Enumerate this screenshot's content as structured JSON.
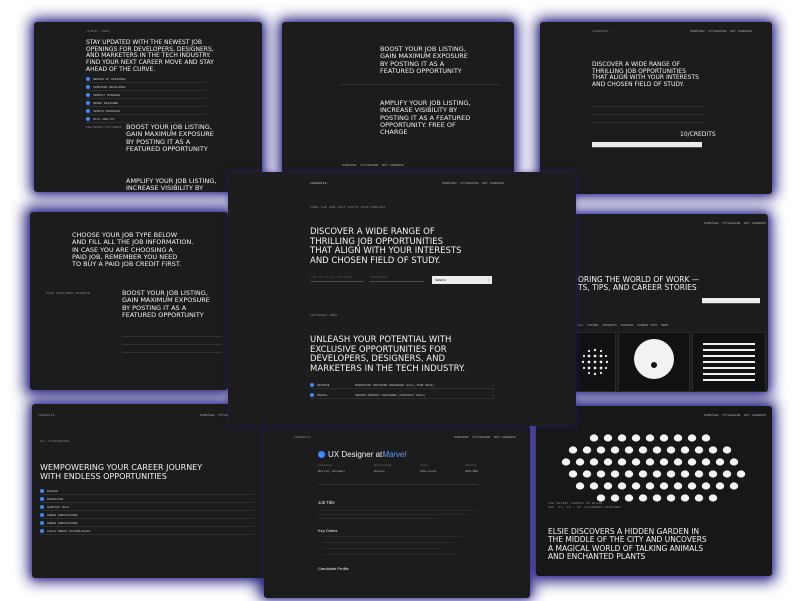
{
  "panels": {
    "p1": {
      "label": "LATEST JOBS",
      "headline": "STAY UPDATED WITH THE NEWEST JOB\nOPENINGS FOR DEVELOPERS, DESIGNERS,\nAND MARKETERS IN THE TECH INDUSTRY.\nFIND YOUR NEXT CAREER MOVE AND STAY\nAHEAD OF THE CURVE.",
      "rows": [
        "SENIOR UX DESIGNER",
        "FRONTEND DEVELOPER",
        "PRODUCT MANAGER",
        "BRAND DESIGNER",
        "GROWTH MARKETER",
        "DATA ANALYST"
      ],
      "section_label": "FEATURED LISTINGS",
      "boost": "BOOST YOUR JOB LISTING,\nGAIN MAXIMUM EXPOSURE\nBY POSTING IT AS A\nFEATURED OPPORTUNITY",
      "amplify": "AMPLIFY YOUR JOB LISTING,\nINCREASE VISIBILITY BY"
    },
    "p2": {
      "nav": [
        "OVERVIEW",
        "STYLEGUIDE",
        "BUY CAREERIA"
      ],
      "boost": "BOOST YOUR JOB LISTING,\nGAIN MAXIMUM EXPOSURE\nBY POSTING IT AS A\nFEATURED OPPORTUNITY",
      "amplify": "AMPLIFY YOUR JOB LISTING,\nINCREASE VISIBILITY BY\nPOSTING IT AS A FEATURED\nOPPORTUNITY. FREE OF\nCHARGE"
    },
    "p3": {
      "brand": "CAREERIA",
      "nav": [
        "OVERVIEW",
        "STYLEGUIDE",
        "BUY CAREERIA"
      ],
      "headline": "DISCOVER A WIDE RANGE OF\nTHRILLING JOB OPPORTUNITIES\nTHAT ALIGN WITH YOUR INTERESTS\nAND CHOSEN FIELD OF STUDY.",
      "credits": "10/CREDITS"
    },
    "p4": {
      "headline": "CHOOSE YOUR JOB TYPE BELOW\nAND FILL ALL THE JOB INFORMATION.\nIN CASE YOU ARE CHOOSING A\nPAID JOB, REMEMBER YOU NEED\nTO BUY A PAID JOB CREDIT FIRST.",
      "label": "PAID FEATURED PROMOTE",
      "boost": "BOOST YOUR JOB LISTING,\nGAIN MAXIMUM EXPOSURE\nBY POSTING IT AS A\nFEATURED OPPORTUNITY"
    },
    "p5": {
      "brand": "CAREERIA",
      "nav": [
        "OVERVIEW",
        "STYLEGUIDE",
        "BUY CAREERIA"
      ],
      "eyebrow": "FIND THE JOB THAT SUITS YOUR PROFILE",
      "headline": "DISCOVER A WIDE RANGE OF\nTHRILLING JOB OPPORTUNITIES\nTHAT ALIGN WITH YOUR INTERESTS\nAND CHOSEN FIELD OF STUDY.",
      "search_placeholder": "JOB TITLE OR KEYWORD",
      "location_placeholder": "LOCATION",
      "search_button": "SEARCH",
      "featured_label": "FEATURED JOBS",
      "unleash": "UNLEASH YOUR POTENTIAL WITH\nEXCLUSIVE OPPORTUNITIES FOR\nDEVELOPERS, DESIGNERS, AND\nMARKETERS IN THE TECH INDUSTRY.",
      "jobs": [
        {
          "company": "ADVANCE",
          "title": "MARKETING SOFTWARE ENGINEER (FULL-TIME ROLE)"
        },
        {
          "company": "MARVEL",
          "title": "SENIOR PRODUCT DESIGNER (CONTRACT ROLE)"
        }
      ]
    },
    "p6": {
      "nav": [
        "OVERVIEW",
        "STYLEGUIDE",
        "BUY CAREERIA"
      ],
      "headline": "ORING THE WORLD OF WORK —\nTS, TIPS, AND CAREER STORIES",
      "filters": [
        "ALL",
        "GUIDES",
        "INSIGHTS",
        "STORIES",
        "CAREER TIPS",
        "NEWS"
      ]
    },
    "p7": {
      "brand": "CAREERIA",
      "nav": [
        "OVERVIEW",
        "STYLEGUIDE"
      ],
      "label": "ALL CATEGORIES",
      "headline": "WEMPOWERING YOUR CAREER JOURNEY\nWITH ENDLESS OPPORTUNITIES",
      "rows": [
        "DESIGN",
        "MARKETING",
        "QUANTUM TECH",
        "GREEN INNOVATIONS",
        "GREEN INNOVATIONS",
        "AGILE WORKS TECHNOLOGIES"
      ]
    },
    "p8": {
      "brand": "CAREERIA",
      "nav": [
        "OVERVIEW",
        "STYLEGUIDE",
        "BUY CAREERIA"
      ],
      "title": "UX Designer at ",
      "company": "Marvel",
      "meta_labels": [
        "Location",
        "Department",
        "Type",
        "Salary"
      ],
      "meta_values": [
        "Berlin, Germany",
        "Design",
        "Mid-Level",
        "€95,000"
      ],
      "section1": "Job Title",
      "section2": "Key Duties",
      "section3": "Candidate Profile"
    },
    "p9": {
      "nav": [
        "OVERVIEW",
        "STYLEGUIDE",
        "BUY CAREERIA"
      ],
      "meta": "THE SECRET GARDEN OF ELSIE\nSEP. 02, 20 — BY ALEJANDRO MARTINEZ",
      "headline": "ELSIE DISCOVERS A HIDDEN GARDEN IN\nTHE MIDDLE OF THE CITY AND UNCOVERS\nA MAGICAL WORLD OF TALKING ANIMALS\nAND ENCHANTED PLANTS"
    }
  }
}
